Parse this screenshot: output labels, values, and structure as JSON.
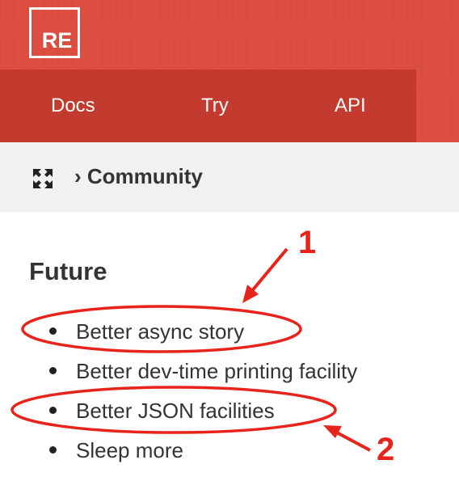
{
  "header": {
    "logo_text": "RE",
    "nav": [
      {
        "label": "Docs"
      },
      {
        "label": "Try"
      },
      {
        "label": "API"
      }
    ],
    "colors": {
      "header_bg": "#db4d3f",
      "nav_bg": "#c33a2f"
    }
  },
  "breadcrumb": {
    "icon": "expand-arrows-icon",
    "text": "› Community"
  },
  "main": {
    "section_title": "Future",
    "items": [
      {
        "label": "Better async story"
      },
      {
        "label": "Better dev-time printing facility"
      },
      {
        "label": "Better JSON facilities"
      },
      {
        "label": "Sleep more"
      }
    ]
  },
  "annotations": {
    "color": "#e8231b",
    "labels": [
      "1",
      "2"
    ]
  }
}
